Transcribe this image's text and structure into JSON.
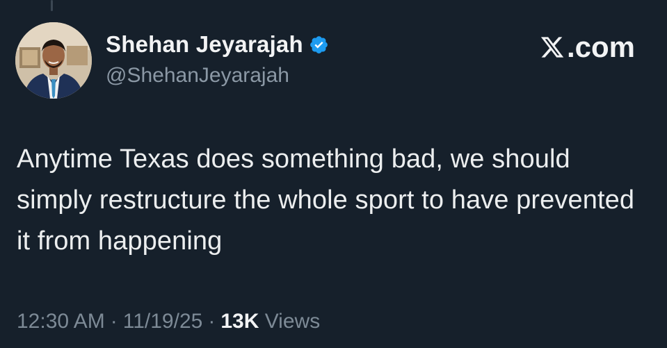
{
  "tweet": {
    "author": {
      "display_name": "Shehan Jeyarajah",
      "handle": "@ShehanJeyarajah",
      "verified": true
    },
    "brand": {
      "text": ".com",
      "icon": "x-logo-icon"
    },
    "body": "Anytime Texas does something bad, we should simply restructure the whole sport to have prevented it from happening",
    "meta": {
      "time": "12:30 AM",
      "date": "11/19/25",
      "separator": "·",
      "views_count": "13K",
      "views_label": "Views"
    }
  },
  "colors": {
    "background": "#16202b",
    "text": "#e7e9ea",
    "secondary_text": "#8b98a5",
    "verified_badge": "#1d9bf0"
  }
}
